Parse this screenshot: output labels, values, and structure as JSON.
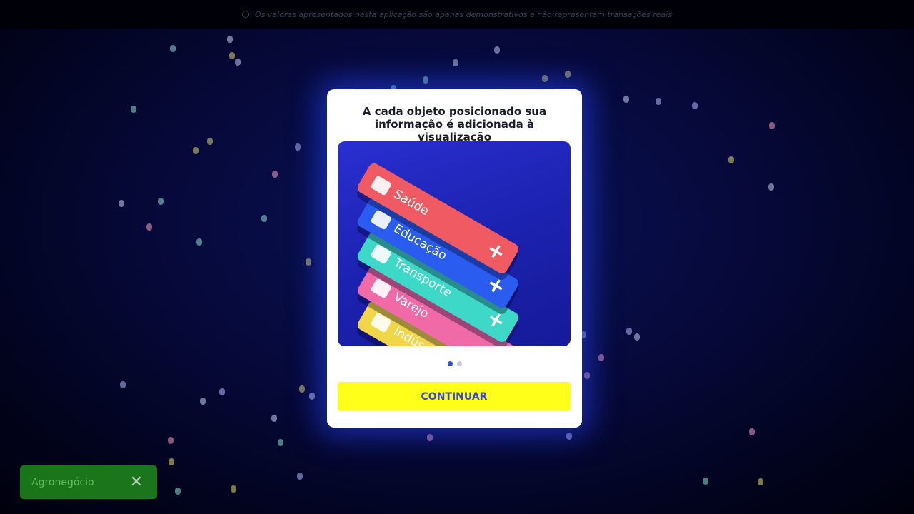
{
  "banner": {
    "icon": "info-icon",
    "text": "Os valores apresentados nesta aplicação são apenas demonstrativos e não representam transações reais"
  },
  "modal": {
    "title": "A cada objeto posicionado sua\ninformação é adicionada à visualização",
    "illustration": {
      "categories": [
        {
          "label": "Saúde",
          "icon": "first-aid-icon",
          "color": "#f05a63"
        },
        {
          "label": "Educação",
          "icon": "graduation-cap-icon",
          "color": "#2a5cf0"
        },
        {
          "label": "Transporte",
          "icon": "car-icon",
          "color": "#3ed8c8"
        },
        {
          "label": "Varejo",
          "icon": "shopping-bag-icon",
          "color": "#f06aa8"
        },
        {
          "label": "Indús",
          "icon": "factory-icon",
          "color": "#f2d64a"
        }
      ],
      "add_symbol": "+"
    },
    "pager": {
      "total": 2,
      "active": 0
    },
    "continue_label": "CONTINUAR"
  },
  "toast": {
    "label": "Agronegócio",
    "close_icon": "close-icon",
    "close_symbol": "✕"
  }
}
